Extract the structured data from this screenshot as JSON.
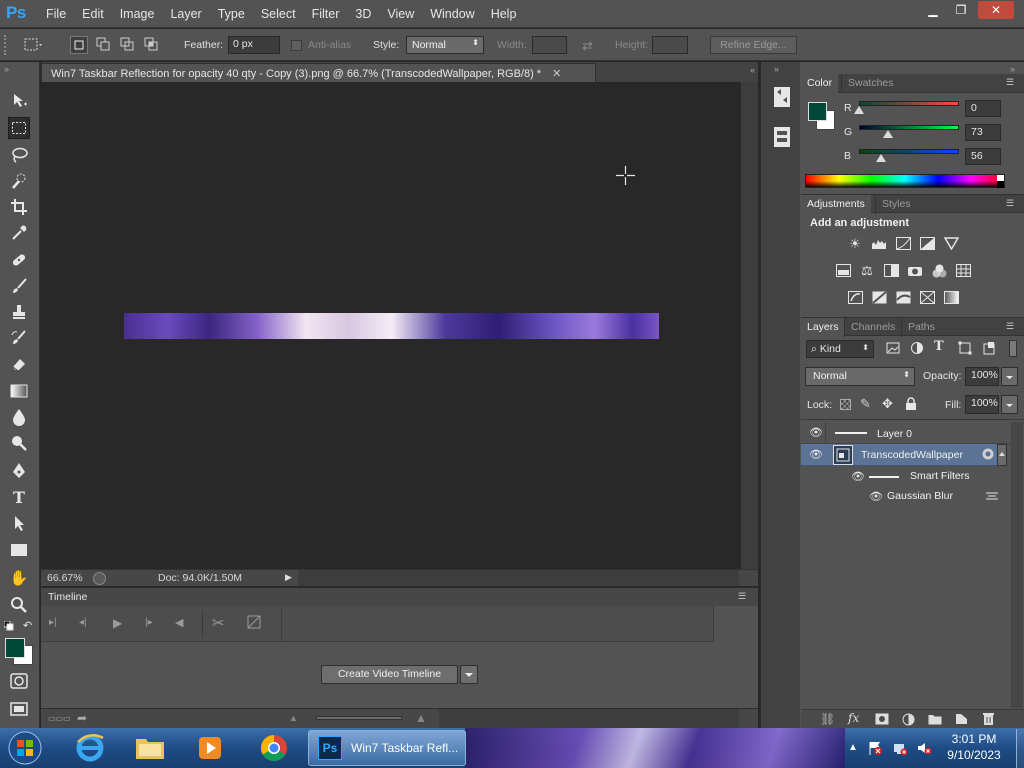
{
  "app": {
    "logo": "Ps"
  },
  "menu": [
    "File",
    "Edit",
    "Image",
    "Layer",
    "Type",
    "Select",
    "Filter",
    "3D",
    "View",
    "Window",
    "Help"
  ],
  "window_controls": {
    "minimize": "▁",
    "restore": "❐",
    "close": "✕"
  },
  "options": {
    "feather_label": "Feather:",
    "feather_value": "0 px",
    "antialias_label": "Anti-alias",
    "style_label": "Style:",
    "style_value": "Normal",
    "width_label": "Width:",
    "height_label": "Height:",
    "refine_edge": "Refine Edge..."
  },
  "document": {
    "tab_title": "Win7 Taskbar Reflection  for opacity 40 qty  - Copy (3).png @ 66.7% (TranscodedWallpaper, RGB/8) *",
    "tab_close": "✕",
    "zoom": "66.67%",
    "doc_size": "Doc: 94.0K/1.50M"
  },
  "timeline": {
    "title": "Timeline",
    "create_button": "Create Video Timeline"
  },
  "color_panel": {
    "tabs": [
      "Color",
      "Swatches"
    ],
    "fg_color": "#004938",
    "bg_color": "#ffffff",
    "channels": [
      {
        "label": "R",
        "value": "0",
        "level": 0
      },
      {
        "label": "G",
        "value": "73",
        "level": 0.286
      },
      {
        "label": "B",
        "value": "56",
        "level": 0.22
      }
    ]
  },
  "adjustments_panel": {
    "tabs": [
      "Adjustments",
      "Styles"
    ],
    "heading": "Add an adjustment"
  },
  "layers_panel": {
    "tabs": [
      "Layers",
      "Channels",
      "Paths"
    ],
    "kind_label": "Kind",
    "blend_mode": "Normal",
    "opacity_label": "Opacity:",
    "opacity_value": "100%",
    "lock_label": "Lock:",
    "fill_label": "Fill:",
    "fill_value": "100%",
    "layers": [
      {
        "name": "Layer 0"
      },
      {
        "name": "TranscodedWallpaper"
      },
      {
        "name": "Smart Filters"
      },
      {
        "name": "Gaussian Blur"
      }
    ]
  },
  "taskbar": {
    "active_app": "Win7 Taskbar Refl...",
    "time": "3:01 PM",
    "date": "9/10/2023"
  }
}
